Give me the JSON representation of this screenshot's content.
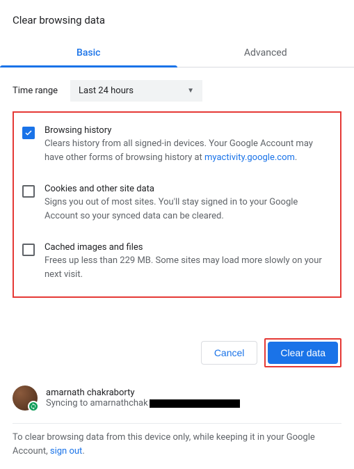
{
  "title": "Clear browsing data",
  "tabs": {
    "basic": "Basic",
    "advanced": "Advanced"
  },
  "time": {
    "label": "Time range",
    "value": "Last 24 hours"
  },
  "options": [
    {
      "title": "Browsing history",
      "desc_a": "Clears history from all signed-in devices. Your Google Account may have other forms of browsing history at ",
      "link": "myactivity.google.com",
      "desc_b": ".",
      "checked": true
    },
    {
      "title": "Cookies and other site data",
      "desc_a": "Signs you out of most sites. You'll stay signed in to your Google Account so your synced data can be cleared.",
      "link": "",
      "desc_b": "",
      "checked": false
    },
    {
      "title": "Cached images and files",
      "desc_a": "Frees up less than 229 MB. Some sites may load more slowly on your next visit.",
      "link": "",
      "desc_b": "",
      "checked": false
    }
  ],
  "buttons": {
    "cancel": "Cancel",
    "clear": "Clear data"
  },
  "profile": {
    "name": "amarnath chakraborty",
    "sync_prefix": "Syncing to amarnathchak"
  },
  "footer": {
    "text_a": "To clear browsing data from this device only, while keeping it in your Google Account, ",
    "link": "sign out",
    "text_b": "."
  }
}
